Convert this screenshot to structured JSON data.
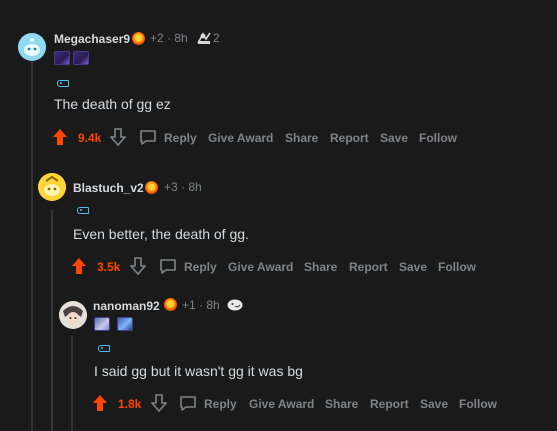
{
  "comments": [
    {
      "username": "Megachaser9",
      "meta": "+2 · 8h",
      "extra_count": "2",
      "body": "The death of gg ez",
      "score": "9.4k"
    },
    {
      "username": "Blastuch_v2",
      "meta": "+3 · 8h",
      "body": "Even better, the death of gg.",
      "score": "3.5k"
    },
    {
      "username": "nanoman92",
      "meta": "+1 · 8h",
      "body": "I said gg but it wasn't gg it was bg",
      "score": "1.8k"
    }
  ],
  "actions": {
    "reply": "Reply",
    "give_award": "Give Award",
    "share": "Share",
    "report": "Report",
    "save": "Save",
    "follow": "Follow"
  },
  "colors": {
    "background": "#1a1a1b",
    "upvoted": "#ff4500",
    "muted": "#818384",
    "text": "#d7dadc",
    "thread_line": "#343536"
  }
}
